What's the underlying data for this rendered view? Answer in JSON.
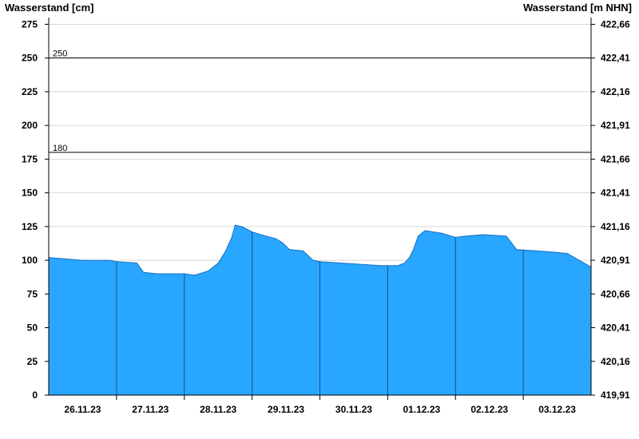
{
  "chart_data": {
    "type": "area",
    "ylabel_left": "Wasserstand [cm]",
    "ylabel_right": "Wasserstand [m NHN]",
    "ylim": [
      0,
      280
    ],
    "y_ticks_left": [
      "0",
      "25",
      "50",
      "75",
      "100",
      "125",
      "150",
      "175",
      "200",
      "225",
      "250",
      "275"
    ],
    "y_ticks_right": [
      "419,91",
      "420,16",
      "420,41",
      "420,66",
      "420,91",
      "421,16",
      "421,41",
      "421,66",
      "421,91",
      "422,16",
      "422,41",
      "422,66"
    ],
    "x_tick_labels": [
      "26.11.23",
      "27.11.23",
      "28.11.23",
      "29.11.23",
      "30.11.23",
      "01.12.23",
      "02.12.23",
      "03.12.23"
    ],
    "reference_lines": [
      {
        "value": 250,
        "label": "250"
      },
      {
        "value": 180,
        "label": "180"
      }
    ],
    "fill_color": "#29a6ff",
    "grid": true,
    "series": [
      {
        "x_days": [
          0,
          0.25,
          0.5,
          0.9,
          1.0,
          1.3,
          1.4,
          1.6,
          2.0,
          2.15,
          2.35,
          2.5,
          2.6,
          2.7,
          2.75,
          2.85,
          3.0,
          3.2,
          3.35,
          3.45,
          3.55,
          3.75,
          3.9,
          4.0,
          4.3,
          4.6,
          4.9,
          5.0,
          5.15,
          5.25,
          5.32,
          5.38,
          5.45,
          5.55,
          5.8,
          6.0,
          6.15,
          6.4,
          6.75,
          6.9,
          7.2,
          7.45,
          7.65,
          8.0
        ],
        "values": [
          102,
          101,
          100,
          100,
          99,
          98,
          91,
          90,
          90,
          89,
          92,
          98,
          106,
          117,
          126,
          125,
          121,
          118,
          116,
          113,
          108,
          107,
          100,
          99,
          98,
          97,
          96,
          96,
          96,
          98,
          102,
          108,
          118,
          122,
          120,
          117,
          118,
          119,
          118,
          108,
          107,
          106,
          105,
          95
        ]
      }
    ]
  }
}
